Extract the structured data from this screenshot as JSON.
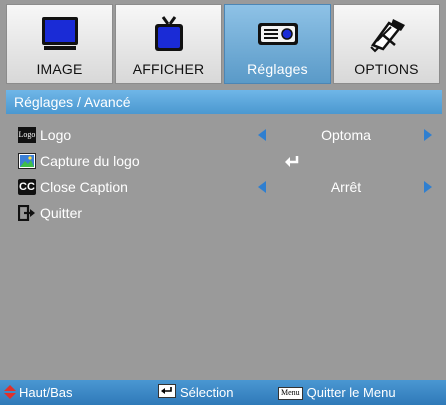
{
  "tabs": [
    {
      "label": "IMAGE",
      "icon": "monitor-icon",
      "active": false
    },
    {
      "label": "AFFICHER",
      "icon": "tv-icon",
      "active": false
    },
    {
      "label": "Réglages",
      "icon": "projector-icon",
      "active": true
    },
    {
      "label": "OPTIONS",
      "icon": "tools-icon",
      "active": false
    }
  ],
  "breadcrumb": "Réglages / Avancé",
  "items": [
    {
      "label": "Logo",
      "icon_text": "Logo",
      "value": "Optoma"
    },
    {
      "label": "Capture du logo",
      "icon": "image-capture-icon"
    },
    {
      "label": "Close Caption",
      "icon_text": "CC",
      "value": "Arrêt"
    },
    {
      "label": "Quitter",
      "icon": "exit-icon"
    }
  ],
  "footer": {
    "nav_label": "Haut/Bas",
    "select_label": "Sélection",
    "menu_key": "Menu",
    "menu_label": "Quitter le Menu"
  },
  "colors": {
    "accent": "#4b98d0",
    "arrow": "#2f7fd0",
    "nav_arrow": "#e0302a"
  }
}
